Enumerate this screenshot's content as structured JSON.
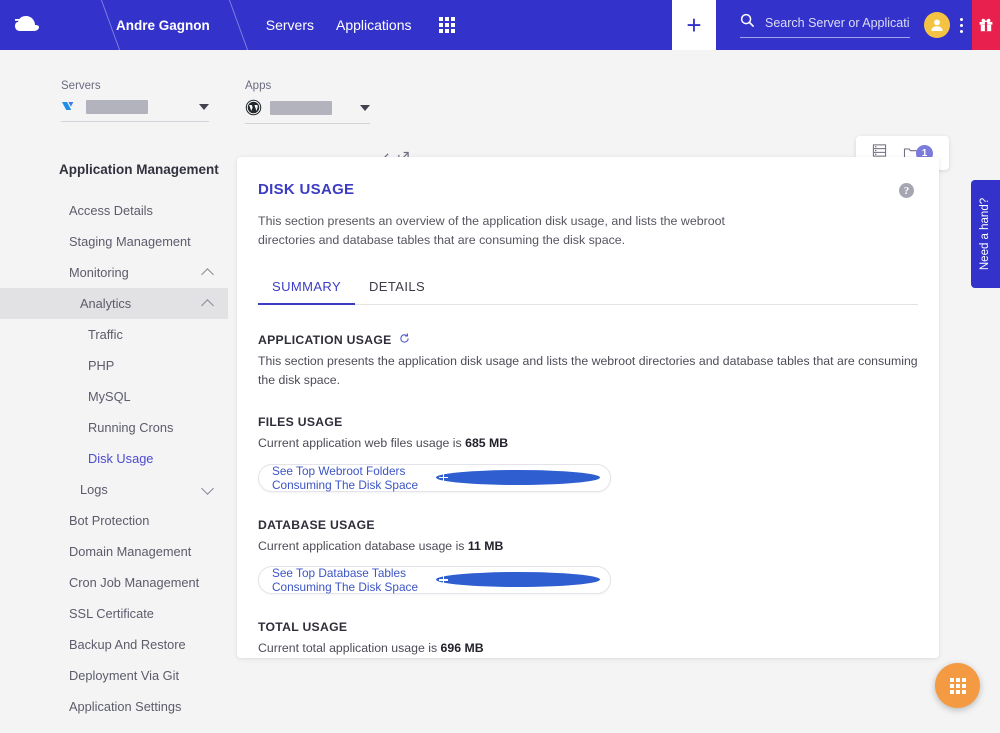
{
  "topbar": {
    "logo": "cloudways-logo",
    "user_name": "Andre Gagnon",
    "nav": [
      {
        "label": "Servers",
        "name": "nav-servers"
      },
      {
        "label": "Applications",
        "name": "nav-applications"
      }
    ],
    "apps_grid_icon": "grid-apps-icon",
    "plus_label": "+",
    "search": {
      "placeholder": "Search Server or Application",
      "value": "",
      "icon": "search-icon"
    },
    "avatar_icon": "user-avatar-icon",
    "kebab_icon": "more-vertical-icon",
    "gift_icon": "gift-icon",
    "colors": {
      "bar": "#3333cc",
      "gift": "#e8204e",
      "avatar": "#f5c344"
    }
  },
  "breadcrumb": {
    "servers_label": "Servers",
    "servers_value": "",
    "apps_label": "Apps",
    "apps_value": "",
    "server_icon": "vultr-logo-icon",
    "app_icon": "wordpress-logo-icon",
    "edit_icon": "pencil-edit-icon",
    "launch_icon": "external-link-icon",
    "separator": "›",
    "viewswitch": {
      "list_icon": "server-list-icon",
      "folder_icon": "folder-icon",
      "badge": "1"
    }
  },
  "sidebar": {
    "title": "Application Management",
    "items": [
      {
        "label": "Access Details",
        "level": 1,
        "state": "normal",
        "chevron": ""
      },
      {
        "label": "Staging Management",
        "level": 1,
        "state": "normal",
        "chevron": ""
      },
      {
        "label": "Monitoring",
        "level": 1,
        "state": "normal",
        "chevron": "up"
      },
      {
        "label": "Analytics",
        "level": 2,
        "state": "highlighted",
        "chevron": "up"
      },
      {
        "label": "Traffic",
        "level": 3,
        "state": "normal",
        "chevron": ""
      },
      {
        "label": "PHP",
        "level": 3,
        "state": "normal",
        "chevron": ""
      },
      {
        "label": "MySQL",
        "level": 3,
        "state": "normal",
        "chevron": ""
      },
      {
        "label": "Running Crons",
        "level": 3,
        "state": "normal",
        "chevron": ""
      },
      {
        "label": "Disk Usage",
        "level": 3,
        "state": "accent",
        "chevron": ""
      },
      {
        "label": "Logs",
        "level": 2,
        "state": "normal",
        "chevron": "down"
      },
      {
        "label": "Bot Protection",
        "level": 1,
        "state": "normal",
        "chevron": ""
      },
      {
        "label": "Domain Management",
        "level": 1,
        "state": "normal",
        "chevron": ""
      },
      {
        "label": "Cron Job Management",
        "level": 1,
        "state": "normal",
        "chevron": ""
      },
      {
        "label": "SSL Certificate",
        "level": 1,
        "state": "normal",
        "chevron": ""
      },
      {
        "label": "Backup And Restore",
        "level": 1,
        "state": "normal",
        "chevron": ""
      },
      {
        "label": "Deployment Via Git",
        "level": 1,
        "state": "normal",
        "chevron": ""
      },
      {
        "label": "Application Settings",
        "level": 1,
        "state": "normal",
        "chevron": ""
      }
    ]
  },
  "card": {
    "title": "DISK USAGE",
    "description": "This section presents an overview of the application disk usage, and lists the webroot directories and database tables that are consuming the disk space.",
    "help_icon": "help-question-icon",
    "tabs": [
      {
        "label": "SUMMARY",
        "selected": true
      },
      {
        "label": "DETAILS",
        "selected": false
      }
    ],
    "application_usage": {
      "heading": "APPLICATION USAGE",
      "refresh_icon": "refresh-icon",
      "description": "This section presents the application disk usage and lists the webroot directories and database tables that are consuming the disk space."
    },
    "files_usage": {
      "heading": "FILES USAGE",
      "text_prefix": "Current application web files usage is ",
      "value": "685 MB",
      "button_label": "See Top Webroot Folders Consuming The Disk Space",
      "button_icon": "plus-circle-icon"
    },
    "database_usage": {
      "heading": "DATABASE USAGE",
      "text_prefix": "Current application database usage is ",
      "value": "11 MB",
      "button_label": "See Top Database Tables Consuming The Disk Space",
      "button_icon": "plus-circle-icon"
    },
    "total_usage": {
      "heading": "TOTAL USAGE",
      "text_prefix": "Current total application usage is ",
      "value": "696 MB"
    }
  },
  "fab": {
    "icon": "grid-apps-icon",
    "color": "#f49a42"
  },
  "help_tab": {
    "label": "Need a hand?",
    "color": "#3333cc"
  }
}
